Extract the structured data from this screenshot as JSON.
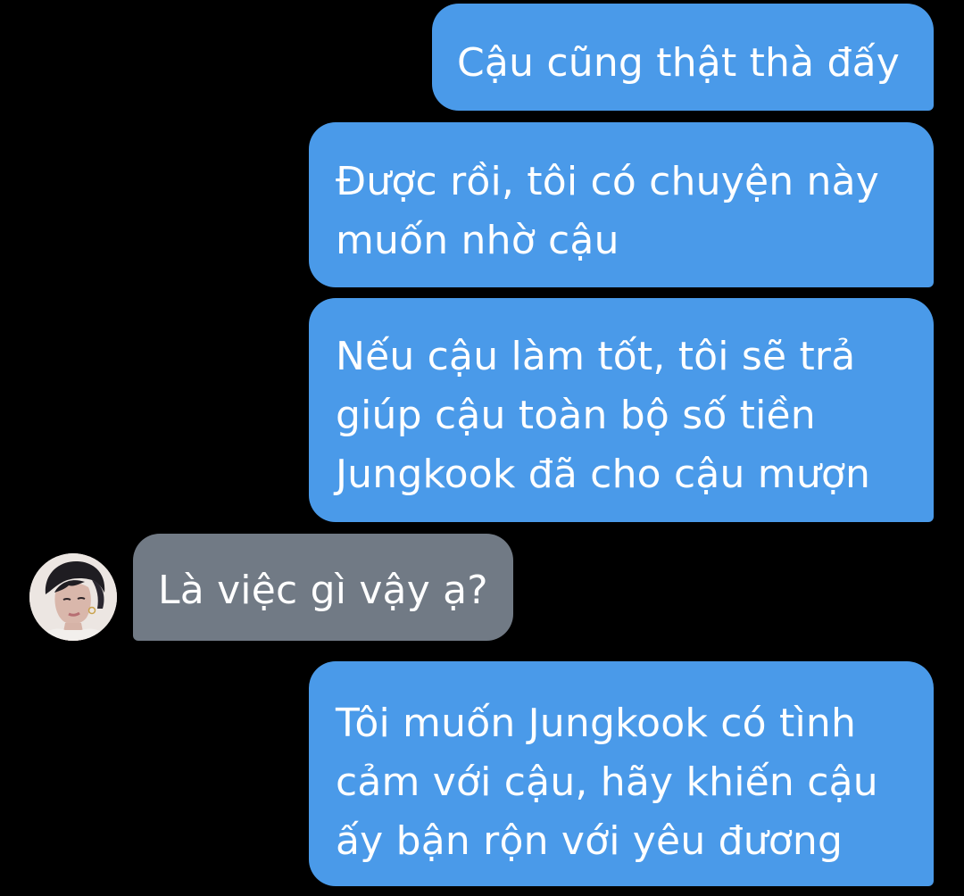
{
  "colors": {
    "background": "#000000",
    "outgoing_bubble": "#4a9ae9",
    "incoming_bubble": "#717a85",
    "text": "#ffffff"
  },
  "conversation": {
    "messages": [
      {
        "sender": "me",
        "text": "Cậu cũng thật thà đấy"
      },
      {
        "sender": "me",
        "text": "Được rồi, tôi có chuyện này\nmuốn nhờ cậu"
      },
      {
        "sender": "me",
        "text": "Nếu cậu làm tốt, tôi sẽ trả\ngiúp cậu toàn bộ số tiền\nJungkook đã cho cậu mượn"
      },
      {
        "sender": "other",
        "text": "Là việc gì vậy ạ?"
      },
      {
        "sender": "me",
        "text": "Tôi muốn Jungkook có tình\ncảm với cậu, hãy khiến cậu\nấy bận rộn với yêu đương"
      }
    ]
  },
  "contact": {
    "avatar_icon": "contact-avatar-photo"
  }
}
